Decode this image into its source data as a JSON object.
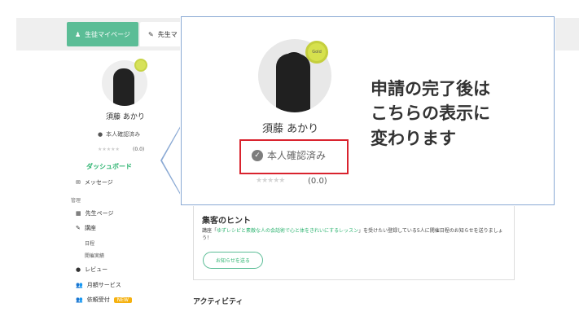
{
  "tabs": [
    {
      "label": "生徒マイページ",
      "icon": "person-icon"
    },
    {
      "label": "先生マ",
      "icon": "pencil-person-icon"
    }
  ],
  "profile": {
    "name": "須藤 あかり",
    "verified": "本人確認済み",
    "stars": "★★★★★",
    "score": "(0.0)",
    "medal": "Gold"
  },
  "sidebar": {
    "dashboard": "ダッシュボード",
    "message": "メッセージ",
    "section_admin": "管理",
    "teacher_page": "先生ページ",
    "course": "講座",
    "schedule": "日程",
    "held": "開催実績",
    "review": "レビュー",
    "monthly": "月額サービス",
    "request": "依頼受付",
    "new_badge": "NEW"
  },
  "hint": {
    "title": "集客のヒント",
    "prefix": "講座「",
    "course": "ゆずレシピと素敵な人の会話術で心と体をきれいにするレッスン",
    "suffix": "」を受けたい登録している5人に開催日程のお知らせを送りましょう！",
    "button": "お知らせを送る"
  },
  "activity": "アクティビティ",
  "overlay_note": "申請の完了後は\nこちらの表示に\n変わります"
}
